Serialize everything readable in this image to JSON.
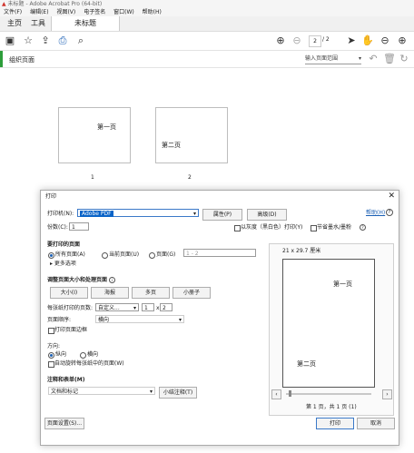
{
  "window": {
    "title": "未标题 - Adobe Acrobat Pro (64-bit)"
  },
  "menu": [
    "文件(F)",
    "编辑(E)",
    "视图(V)",
    "电子签名",
    "窗口(W)",
    "帮助(H)"
  ],
  "tabs": {
    "home": "主页",
    "tools": "工具",
    "document": "未标题"
  },
  "nav": {
    "current_page": "2",
    "total_pages": "/ 2"
  },
  "subbar": {
    "title": "组织页面",
    "page_range_placeholder": "输入页面范围"
  },
  "pages": [
    {
      "text": "第一页",
      "number": "1"
    },
    {
      "text": "第二页",
      "number": "2"
    }
  ],
  "print_dialog": {
    "title": "打印",
    "printer_label": "打印机(N):",
    "printer_value": "Adobe PDF",
    "properties_button": "属性(P)",
    "advanced_button": "高级(D)",
    "help_link": "帮助(H)",
    "copies_label": "份数(C):",
    "copies_value": "1",
    "grayscale_label": "以灰度（黑白色）打印(Y)",
    "save_ink_label": "节省墨水/墨粉",
    "pages_section": "要打印的页面",
    "all_pages": "所有页面(A)",
    "current_page": "当前页面(U)",
    "pages_option": "页面(G)",
    "pages_range_value": "1 - 2",
    "more_options": "▸ 更多选项",
    "size_section": "调整页面大小和处理页面",
    "size_buttons": [
      "大小(I)",
      "海报",
      "多页",
      "小册子"
    ],
    "pages_per_sheet_label": "每张纸打印的页数:",
    "pages_per_sheet_value": "自定义...",
    "cols": "1",
    "by": "x",
    "rows": "2",
    "page_order_label": "页面顺序:",
    "page_order_value": "横向",
    "print_border_label": "打印页面边框",
    "orientation_label": "方向:",
    "portrait": "纵向",
    "landscape": "横向",
    "auto_rotate": "自动旋转每张纸中的页面(W)",
    "comments_section": "注释和表单(M)",
    "comments_value": "文档和标记",
    "summarize_button": "小结注释(T)",
    "page_setup_button": "页面设置(S)...",
    "print_button": "打印",
    "cancel_button": "取消",
    "preview": {
      "size_label": "21 x 29.7 厘米",
      "page1_text": "第一页",
      "page2_text": "第二页",
      "page_status": "第 1 页，共 1 页 (1)"
    }
  }
}
